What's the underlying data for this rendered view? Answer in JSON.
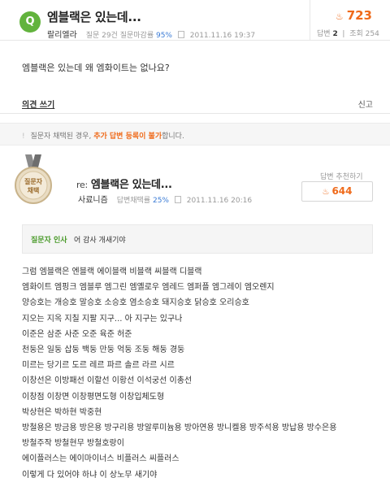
{
  "question": {
    "badge": "Q",
    "title": "엠블랙은 있는데...",
    "author": "랄리엘라",
    "stats_text": "질문 29건 질문마감률",
    "close_rate": "95%",
    "date": "2011.11.16 19:37",
    "points": "723",
    "answers_label": "답변",
    "answers_count": "2",
    "views_label": "조회",
    "views_count": "254",
    "body": "엠블랙은 있는데 왜 엠화이트는 없나요?"
  },
  "opinion_link": "의견 쓰기",
  "report_link": "신고",
  "notice": {
    "icon": "!",
    "prefix": "질문자 채택된 경우,",
    "emphasis": "추가 답변 등록이 불가",
    "suffix": "합니다."
  },
  "answer": {
    "medal_line1": "질문자",
    "medal_line2": "채택",
    "re": "re:",
    "title": "엠블랙은 있는데...",
    "author": "사료니즘",
    "stats_text": "답변채택률",
    "adopt_rate": "25%",
    "date": "2011.11.16 20:16",
    "recommend_label": "답변 추천하기",
    "recommend_points": "644",
    "thanks_label": "질문자 인사",
    "thanks_text": "어 감사 개새기야",
    "lines": [
      "그럼 엠블랙은 엔블랙 에이블랙 비블랙 씨블랙 디블랙",
      "엠화이트 엠핑크 엠블루 엠그린 엠옐로우 엠레드 엠퍼플 엠그레이 엠오렌지",
      "양승호는 개승호 말승호 소승호 염소승호 돼지승호 닭승호 오리승호",
      "지오는 지옥 지칠 지팔 지구... 아 지구는 있구나",
      "이준은 삼준 사준 오준 육준 허준",
      "천둥은 일둥 삽둥 백둥 만둥 억둥 조둥 해둥 경둥",
      "미르는 당기르 도르 레르 파르 솔르 라르 시르",
      "이창선은 이방패선 이할선 이황선 이석궁선 이총선",
      "이창점 이창면 이창평면도형 이창입체도형",
      "박상현은 박하현 박중현",
      "방철용은 방금용 방은용 방구리용 방알루미늄용 방아연용 방니켈용 방주석용 방납용 방수은용",
      "방철주작 방철현무 방철호랑이",
      "에이플러스는 에이마이너스 비플러스 씨플러스",
      "이렇게 다 있어야 하냐 이 상노무 새기야"
    ]
  },
  "colors": {
    "green": "#62b33d",
    "orange": "#ef6a1a",
    "blue": "#3a7bd5"
  }
}
